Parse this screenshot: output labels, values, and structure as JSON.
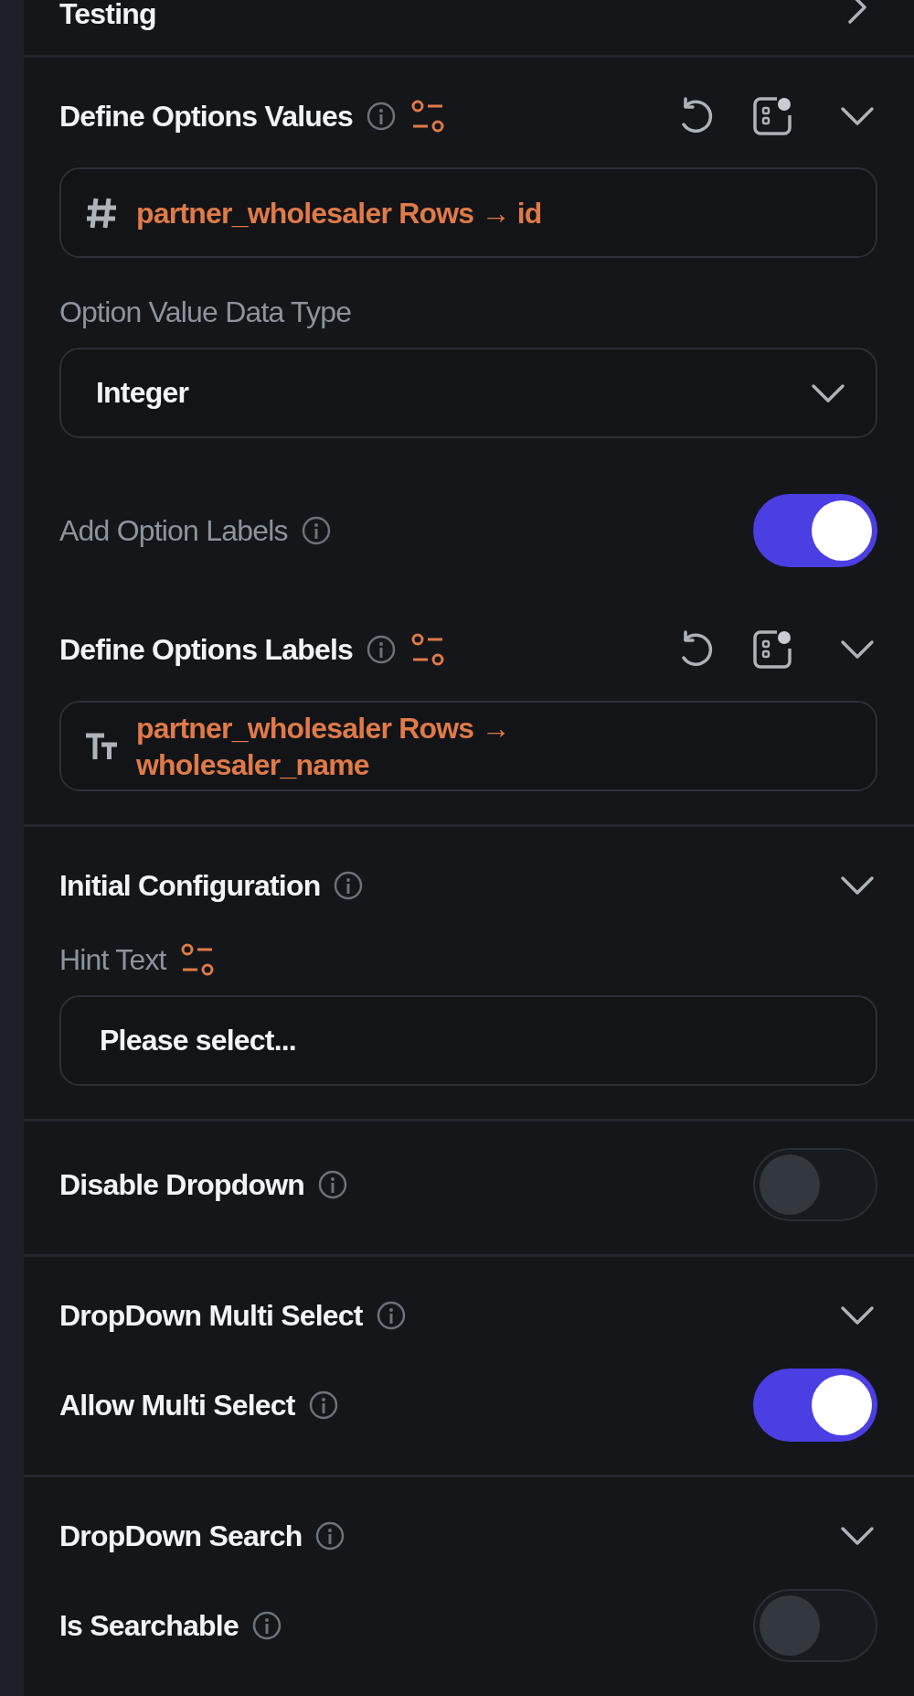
{
  "top_row": {
    "title": "Testing",
    "expanded": false
  },
  "sections": [
    {
      "items": [
        {
          "kind": "header",
          "title": "Define Options Values",
          "tools": true,
          "expanded": true
        },
        {
          "kind": "binding",
          "value": "partner_wholesaler Rows → id"
        },
        {
          "kind": "label",
          "text": "Option Value Data Type",
          "variable": false
        },
        {
          "kind": "select",
          "value": "Integer"
        },
        {
          "kind": "toggle",
          "label": "Add Option Labels",
          "secondary": true,
          "on": true
        },
        {
          "kind": "header",
          "title": "Define Options Labels",
          "tools": true,
          "expanded": true
        },
        {
          "kind": "binding",
          "value": "partner_wholesaler Rows → wholesaler_name"
        }
      ]
    },
    {
      "items": [
        {
          "kind": "header",
          "title": "Initial Configuration",
          "tools": false,
          "expanded": true
        },
        {
          "kind": "label",
          "text": "Hint Text",
          "variable": true
        },
        {
          "kind": "input",
          "value": "Please select..."
        }
      ]
    },
    {
      "items": [
        {
          "kind": "toggle",
          "label": "Disable Dropdown",
          "secondary": false,
          "on": false
        }
      ]
    },
    {
      "items": [
        {
          "kind": "header",
          "title": "DropDown Multi Select",
          "tools": false,
          "expanded": true
        },
        {
          "kind": "toggle",
          "label": "Allow Multi Select",
          "secondary": false,
          "on": true
        }
      ]
    },
    {
      "items": [
        {
          "kind": "header",
          "title": "DropDown Search",
          "tools": false,
          "expanded": true
        },
        {
          "kind": "toggle",
          "label": "Is Searchable",
          "secondary": false,
          "on": false
        }
      ]
    }
  ]
}
